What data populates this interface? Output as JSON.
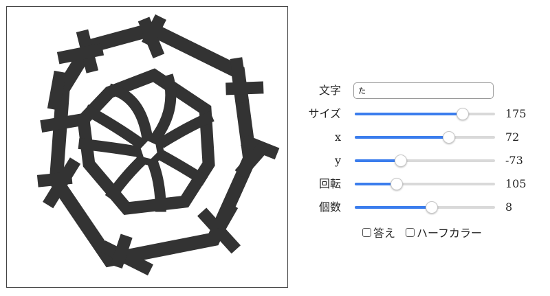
{
  "controls": {
    "text": {
      "label": "文字",
      "value": "た"
    },
    "size": {
      "label": "サイズ",
      "value": 175,
      "fraction": 0.77
    },
    "x": {
      "label": "x",
      "value": 72,
      "fraction": 0.67
    },
    "y": {
      "label": "y",
      "value": -73,
      "fraction": 0.33
    },
    "rotation": {
      "label": "回転",
      "value": 105,
      "fraction": 0.3
    },
    "count": {
      "label": "個数",
      "value": 8,
      "fraction": 0.55
    }
  },
  "checkboxes": {
    "answer": {
      "label": "答え",
      "checked": false
    },
    "halfcolor": {
      "label": "ハーフカラー",
      "checked": false
    }
  },
  "colors": {
    "accent": "#3b7ded",
    "pattern": "#333333"
  }
}
